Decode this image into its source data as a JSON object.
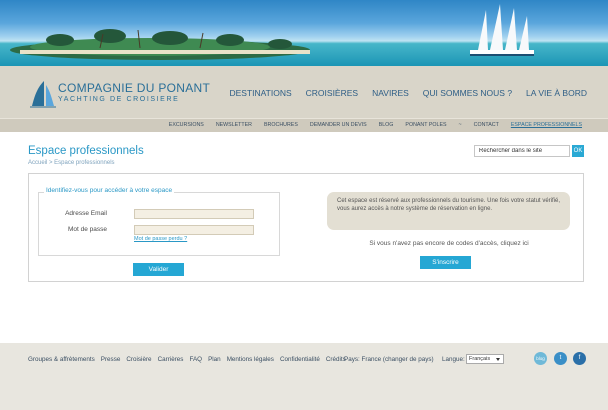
{
  "brand": {
    "name": "COMPAGNIE DU PONANT",
    "tagline": "YACHTING DE CROISIERE",
    "accent": "#2aa9d4"
  },
  "main_nav": [
    "DESTINATIONS",
    "CROISIÈRES",
    "NAVIRES",
    "QUI SOMMES NOUS ?",
    "LA VIE À BORD"
  ],
  "sub_nav": [
    "EXCURSIONS",
    "NEWSLETTER",
    "BROCHURES",
    "DEMANDER UN DEVIS",
    "BLOG",
    "PONANT POLES",
    "~",
    "CONTACT",
    "ESPACE PROFESSIONNELS"
  ],
  "page": {
    "title": "Espace professionnels",
    "breadcrumb": "Accueil > Espace professionnels"
  },
  "search": {
    "value": "Rechercher dans le site",
    "button": "OK"
  },
  "login": {
    "legend": "Identifiez-vous pour accéder à votre espace",
    "email_label": "Adresse Email",
    "password_label": "Mot de passe",
    "forgot": "Mot de passe perdu ?",
    "submit": "Valider"
  },
  "info": {
    "text": "Cet espace est réservé aux professionnels du tourisme. Une fois votre statut vérifié, vous aurez accès à notre système de réservation en ligne.",
    "no_access": "Si vous n'avez pas encore de codes d'accès, cliquez ici",
    "signup": "S'inscrire"
  },
  "footer": {
    "links": [
      "Groupes & affrètements",
      "Presse",
      "Croisière",
      "Carrières",
      "FAQ",
      "Plan",
      "Mentions légales",
      "Confidentialité",
      "Crédits"
    ],
    "country": "Pays: France (changer de pays)",
    "language_label": "Langue:",
    "language_value": "Français",
    "social": [
      {
        "name": "blog-icon",
        "label": "blog",
        "color": "#6fb9d8"
      },
      {
        "name": "twitter-icon",
        "label": "t",
        "color": "#3a8fc7"
      },
      {
        "name": "facebook-icon",
        "label": "f",
        "color": "#2a6fa8"
      }
    ]
  }
}
